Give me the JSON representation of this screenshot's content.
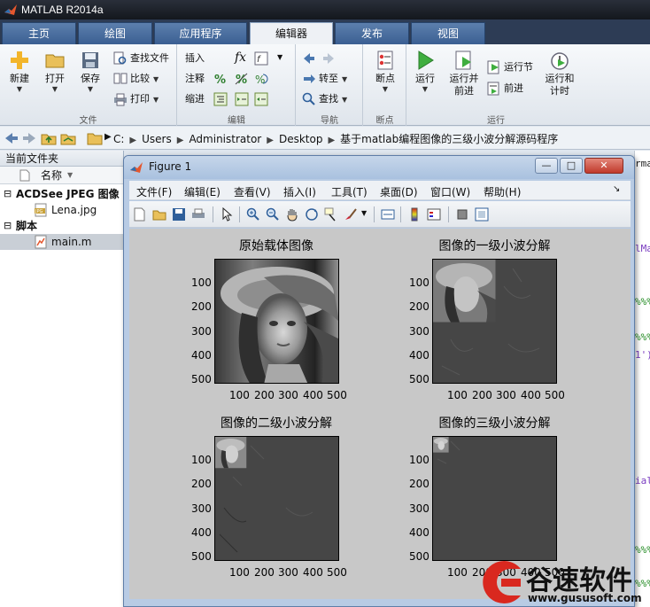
{
  "app": {
    "title": "MATLAB R2014a",
    "tabs": [
      "主页",
      "绘图",
      "应用程序",
      "编辑器",
      "发布",
      "视图"
    ],
    "active_tab": "编辑器"
  },
  "ribbon": {
    "file": {
      "new": "新建",
      "open": "打开",
      "save": "保存",
      "find_files": "查找文件",
      "compare": "比较",
      "print": "打印",
      "section": "文件"
    },
    "edit": {
      "insert": "插入",
      "comment": "注释",
      "indent": "缩进",
      "fx": "fx",
      "section": "编辑"
    },
    "navigate": {
      "goto": "转至",
      "find": "查找",
      "section": "导航"
    },
    "breakpoints": {
      "breakpoints": "断点",
      "section": "断点"
    },
    "run": {
      "run": "运行",
      "run_advance": "运行并\n前进",
      "run_section": "运行节",
      "advance": "前进",
      "run_time": "运行和\n计时",
      "section": "运行"
    }
  },
  "address": {
    "crumbs": [
      "C:",
      "Users",
      "Administrator",
      "Desktop",
      "基于matlab编程图像的三级小波分解源码程序"
    ]
  },
  "current_folder": {
    "title": "当前文件夹",
    "column": "名称",
    "groups": [
      {
        "label": "ACDSee JPEG 图像",
        "files": [
          "Lena.jpg"
        ]
      },
      {
        "label": "脚本",
        "files": [
          "main.m"
        ]
      }
    ]
  },
  "editor_peek": {
    "fragments": [
      "rma",
      "lMa",
      "%%%",
      "%%%",
      "1')",
      "ial",
      "%%%",
      "%%%"
    ]
  },
  "figure": {
    "title": "Figure 1",
    "menus": [
      "文件(F)",
      "编辑(E)",
      "查看(V)",
      "插入(I)",
      "工具(T)",
      "桌面(D)",
      "窗口(W)",
      "帮助(H)"
    ],
    "window_buttons": [
      "—",
      "□",
      "✕"
    ],
    "subplots": [
      {
        "title": "原始载体图像",
        "level": 0
      },
      {
        "title": "图像的一级小波分解",
        "level": 1
      },
      {
        "title": "图像的二级小波分解",
        "level": 2
      },
      {
        "title": "图像的三级小波分解",
        "level": 3
      }
    ],
    "xticks": [
      "100",
      "200",
      "300",
      "400",
      "500"
    ],
    "yticks": [
      "100",
      "200",
      "300",
      "400",
      "500"
    ]
  },
  "watermark": {
    "brand": "谷速软件",
    "url": "www.gususoft.com"
  },
  "colors": {
    "tab_bg": "#3b5f92",
    "ribbon_bg": "#eef1f5",
    "figure_bg": "#c8c8c8",
    "detail_gray": "#464646",
    "watermark_red": "#d9281f"
  }
}
